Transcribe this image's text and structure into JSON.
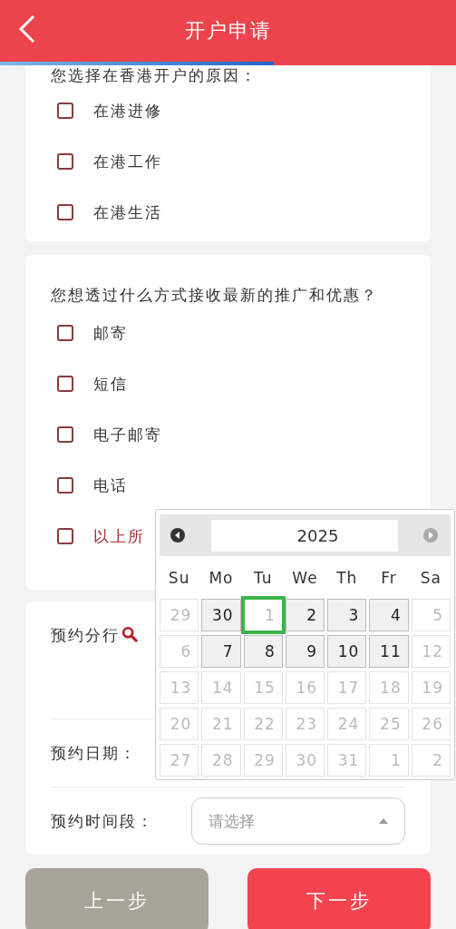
{
  "header": {
    "title": "开户申请",
    "progress": {
      "level": 0.6
    }
  },
  "reasons": {
    "question": "您选择在香港开户的原因：",
    "options": [
      {
        "label": "在港进修",
        "checked": false
      },
      {
        "label": "在港工作",
        "checked": false
      },
      {
        "label": "在港生活",
        "checked": false
      }
    ]
  },
  "promotions": {
    "question": "您想透过什么方式接收最新的推广和优惠？",
    "options": [
      {
        "label": "邮寄",
        "checked": false,
        "highlighted": false
      },
      {
        "label": "短信",
        "checked": false,
        "highlighted": false
      },
      {
        "label": "电子邮寄",
        "checked": false,
        "highlighted": false
      },
      {
        "label": "电话",
        "checked": false,
        "highlighted": false
      },
      {
        "label": "以上所",
        "checked": false,
        "highlighted": true
      }
    ]
  },
  "appointment": {
    "branch_label": "预约分行",
    "date_label": "预约日期：",
    "time_label": "预约时间段：",
    "time_select": {
      "placeholder": "请选择"
    }
  },
  "datepicker": {
    "year": "2025",
    "prev_disabled": false,
    "next_disabled": true,
    "weekdays": [
      "Su",
      "Mo",
      "Tu",
      "We",
      "Th",
      "Fr",
      "Sa"
    ],
    "days": [
      {
        "label": "29",
        "disabled": true,
        "highlighted": false
      },
      {
        "label": "30",
        "disabled": false,
        "highlighted": false
      },
      {
        "label": "1",
        "disabled": true,
        "highlighted": true
      },
      {
        "label": "2",
        "disabled": false,
        "highlighted": false
      },
      {
        "label": "3",
        "disabled": false,
        "highlighted": false
      },
      {
        "label": "4",
        "disabled": false,
        "highlighted": false
      },
      {
        "label": "5",
        "disabled": true,
        "highlighted": false
      },
      {
        "label": "6",
        "disabled": true,
        "highlighted": false
      },
      {
        "label": "7",
        "disabled": false,
        "highlighted": false
      },
      {
        "label": "8",
        "disabled": false,
        "highlighted": false
      },
      {
        "label": "9",
        "disabled": false,
        "highlighted": false
      },
      {
        "label": "10",
        "disabled": false,
        "highlighted": false
      },
      {
        "label": "11",
        "disabled": false,
        "highlighted": false
      },
      {
        "label": "12",
        "disabled": true,
        "highlighted": false
      },
      {
        "label": "13",
        "disabled": true,
        "highlighted": false
      },
      {
        "label": "14",
        "disabled": true,
        "highlighted": false
      },
      {
        "label": "15",
        "disabled": true,
        "highlighted": false
      },
      {
        "label": "16",
        "disabled": true,
        "highlighted": false
      },
      {
        "label": "17",
        "disabled": true,
        "highlighted": false
      },
      {
        "label": "18",
        "disabled": true,
        "highlighted": false
      },
      {
        "label": "19",
        "disabled": true,
        "highlighted": false
      },
      {
        "label": "20",
        "disabled": true,
        "highlighted": false
      },
      {
        "label": "21",
        "disabled": true,
        "highlighted": false
      },
      {
        "label": "22",
        "disabled": true,
        "highlighted": false
      },
      {
        "label": "23",
        "disabled": true,
        "highlighted": false
      },
      {
        "label": "24",
        "disabled": true,
        "highlighted": false
      },
      {
        "label": "25",
        "disabled": true,
        "highlighted": false
      },
      {
        "label": "26",
        "disabled": true,
        "highlighted": false
      },
      {
        "label": "27",
        "disabled": true,
        "highlighted": false
      },
      {
        "label": "28",
        "disabled": true,
        "highlighted": false
      },
      {
        "label": "29",
        "disabled": true,
        "highlighted": false
      },
      {
        "label": "30",
        "disabled": true,
        "highlighted": false
      },
      {
        "label": "31",
        "disabled": true,
        "highlighted": false
      },
      {
        "label": "1",
        "disabled": true,
        "highlighted": false
      },
      {
        "label": "2",
        "disabled": true,
        "highlighted": false
      }
    ]
  },
  "buttons": [
    {
      "label": "上一步",
      "kind": "secondary"
    },
    {
      "label": "下一步",
      "kind": "primary"
    }
  ]
}
